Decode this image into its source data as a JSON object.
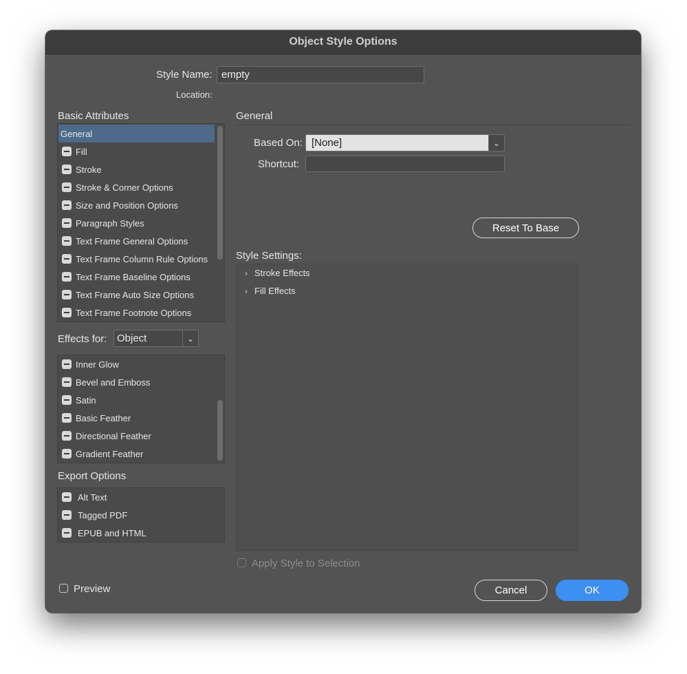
{
  "dialog": {
    "title": "Object Style Options"
  },
  "style_name": {
    "label": "Style Name:",
    "value": "empty"
  },
  "location": {
    "label": "Location:"
  },
  "basic_attributes": {
    "heading": "Basic Attributes",
    "items": [
      "General",
      "Fill",
      "Stroke",
      "Stroke & Corner Options",
      "Size and Position Options",
      "Paragraph Styles",
      "Text Frame General Options",
      "Text Frame Column Rule Options",
      "Text Frame Baseline Options",
      "Text Frame Auto Size Options",
      "Text Frame Footnote Options"
    ],
    "selected": "General"
  },
  "effects_for": {
    "label": "Effects for:",
    "value": "Object",
    "items": [
      "Inner Glow",
      "Bevel and Emboss",
      "Satin",
      "Basic Feather",
      "Directional Feather",
      "Gradient Feather"
    ]
  },
  "export_options": {
    "heading": "Export Options",
    "items": [
      "Alt Text",
      "Tagged PDF",
      "EPUB and HTML"
    ]
  },
  "general": {
    "heading": "General",
    "based_on_label": "Based On:",
    "based_on_value": "[None]",
    "shortcut_label": "Shortcut:",
    "shortcut_value": "",
    "reset_button": "Reset To Base"
  },
  "style_settings": {
    "label": "Style Settings:",
    "items": [
      "Stroke Effects",
      "Fill Effects"
    ]
  },
  "apply_to_selection": {
    "label": "Apply Style to Selection",
    "checked": false
  },
  "preview": {
    "label": "Preview",
    "checked": false
  },
  "buttons": {
    "cancel": "Cancel",
    "ok": "OK"
  },
  "icons": {
    "mixed_checkbox": "minus-checkbox-icon",
    "dropdown_arrow": "chevron-down-icon",
    "tree_expand": "chevron-right-icon"
  },
  "colors": {
    "selection": "#4d6a8a",
    "primary_button": "#3d8ff2",
    "dialog_bg": "#535353"
  }
}
